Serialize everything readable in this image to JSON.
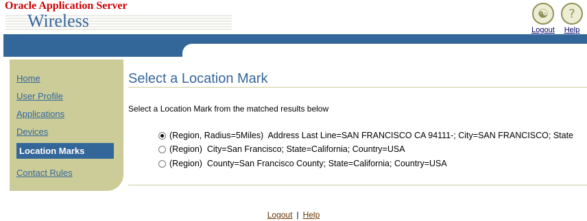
{
  "header": {
    "brand_top": "Oracle Application Server",
    "brand_main": "Wireless",
    "logout_label": "Logout",
    "help_label": "Help",
    "logout_icon": "logout-icon",
    "help_icon": "help-icon"
  },
  "sidebar": {
    "items": [
      {
        "label": "Home",
        "selected": false
      },
      {
        "label": "User Profile",
        "selected": false
      },
      {
        "label": "Applications",
        "selected": false
      },
      {
        "label": "Devices",
        "selected": false
      },
      {
        "label": "Location Marks",
        "selected": true
      },
      {
        "label": "Contact Rules",
        "selected": false
      }
    ]
  },
  "main": {
    "title": "Select a Location Mark",
    "instruction": "Select a Location Mark from the matched results below",
    "options": [
      {
        "text": "(Region, Radius=5Miles)  Address Last Line=SAN FRANCISCO CA 94111-; City=SAN FRANCISCO; State",
        "checked": true
      },
      {
        "text": "(Region)  City=San Francisco; State=California; Country=USA",
        "checked": false
      },
      {
        "text": "(Region)  County=San Francisco County; State=California; Country=USA",
        "checked": false
      }
    ]
  },
  "footer": {
    "logout_label": "Logout",
    "separator": "|",
    "help_label": "Help"
  },
  "colors": {
    "brand_red": "#cc0000",
    "accent_blue": "#336699",
    "nav_tan": "#cccc99"
  }
}
